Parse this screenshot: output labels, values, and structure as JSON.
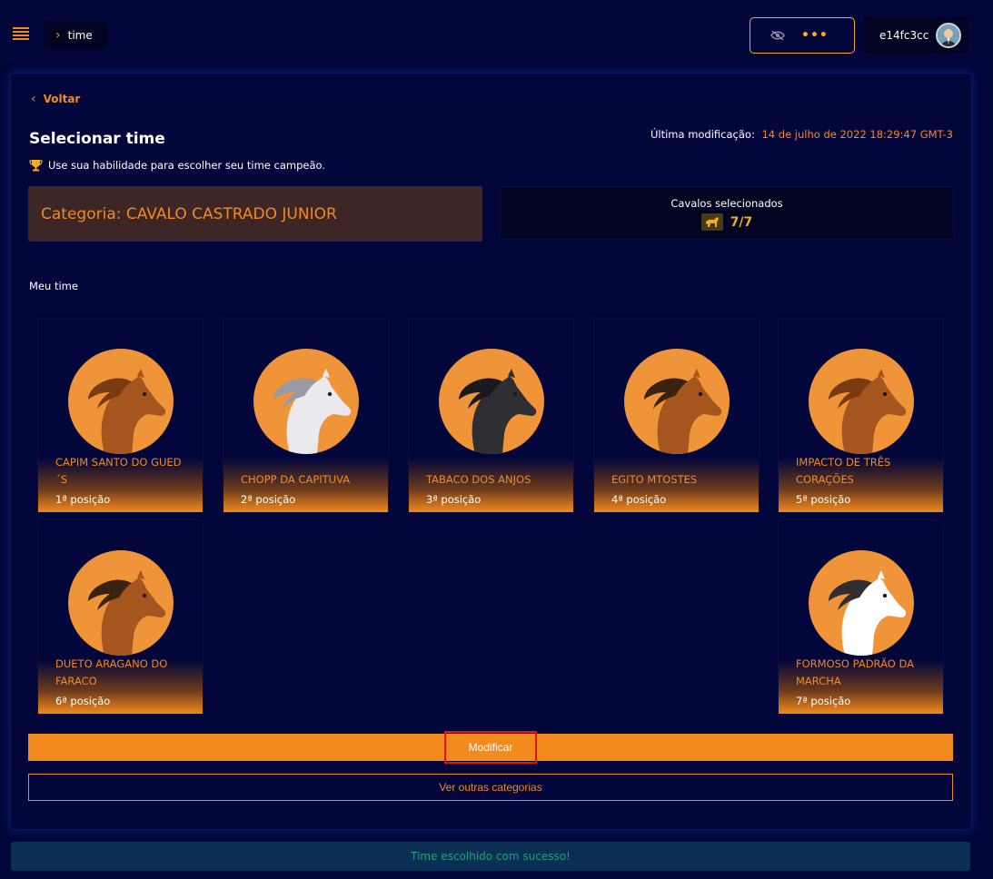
{
  "header": {
    "breadcrumb": "time",
    "username": "e14fc3cc",
    "visibility_dots": "•••"
  },
  "page": {
    "back_label": "Voltar",
    "title": "Selecionar time",
    "subtitle": "Use sua habilidade para escolher seu time campeão.",
    "last_modified_label": "Última modificação:",
    "last_modified_value": "14 de julho de 2022 18:29:47 GMT-3",
    "category": "Categoria: CAVALO CASTRADO JUNIOR",
    "selected_label": "Cavalos selecionados",
    "selected_count": "7/7",
    "team_label": "Meu time"
  },
  "horses": [
    {
      "name": "CAPIM SANTO DO GUED´S",
      "position": "1ª posição",
      "coat": "#a5561f",
      "mane": "#7a3a12"
    },
    {
      "name": "CHOPP DA CAPITUVA",
      "position": "2ª posição",
      "coat": "#e9e9ee",
      "mane": "#9a9aa5"
    },
    {
      "name": "TABACO DOS ANJOS",
      "position": "3ª posição",
      "coat": "#2e2e33",
      "mane": "#1a1a1e"
    },
    {
      "name": "EGITO MTOSTES",
      "position": "4ª posição",
      "coat": "#a5561f",
      "mane": "#3a2210"
    },
    {
      "name": "IMPACTO DE TRÊS CORAÇÕES",
      "position": "5ª posição",
      "coat": "#a5561f",
      "mane": "#7a3a12"
    },
    {
      "name": "DUETO ARAGANO DO FARACO",
      "position": "6ª posição",
      "coat": "#a5561f",
      "mane": "#3a2210"
    },
    {
      "name": "FORMOSO PADRÃO DA MARCHA",
      "position": "7ª posição",
      "coat": "#ffffff",
      "mane": "#2e2e33"
    }
  ],
  "actions": {
    "modify_label": "Modificar",
    "other_categories_label": "Ver outras categorias"
  },
  "toast": {
    "message": "Time escolhido com sucesso!"
  },
  "colors": {
    "accent": "#f28a1e",
    "background": "#02063a",
    "success": "#19a37a"
  }
}
